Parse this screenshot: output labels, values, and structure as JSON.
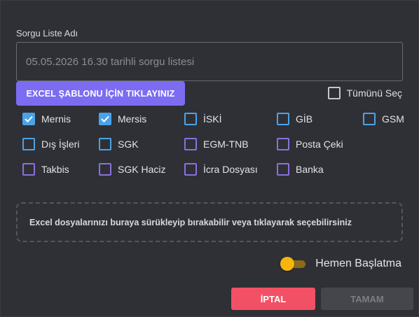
{
  "form": {
    "list_name_label": "Sorgu Liste Adı",
    "list_name_placeholder": "05.05.2026 16.30 tarihli sorgu listesi",
    "excel_template_button": "EXCEL ŞABLONU İÇİN TIKLAYINIZ",
    "select_all_label": "Tümünü Seç"
  },
  "sources": [
    {
      "id": "mernis",
      "label": "Mernis",
      "checked": true,
      "color": "#4aa3e8"
    },
    {
      "id": "mersis",
      "label": "Mersis",
      "checked": true,
      "color": "#4aa3e8"
    },
    {
      "id": "iski",
      "label": "İSKİ",
      "checked": false,
      "color": "#4aa3e8"
    },
    {
      "id": "gib",
      "label": "GİB",
      "checked": false,
      "color": "#4aa3e8"
    },
    {
      "id": "gsm",
      "label": "GSM",
      "checked": false,
      "color": "#4aa3e8"
    },
    {
      "id": "dis-isleri",
      "label": "Dış İşleri",
      "checked": false,
      "color": "#4aa3e8"
    },
    {
      "id": "sgk",
      "label": "SGK",
      "checked": false,
      "color": "#4aa3e8"
    },
    {
      "id": "egm-tnb",
      "label": "EGM-TNB",
      "checked": false,
      "color": "#8b6fe0"
    },
    {
      "id": "posta-ceki",
      "label": "Posta Çeki",
      "checked": false,
      "color": "#8b6fe0"
    },
    {
      "id": "takbis",
      "label": "Takbis",
      "checked": false,
      "color": "#8b6fe0"
    },
    {
      "id": "sgk-haciz",
      "label": "SGK Haciz",
      "checked": false,
      "color": "#8b6fe0"
    },
    {
      "id": "icra-dosyasi",
      "label": "İcra Dosyası",
      "checked": false,
      "color": "#8b6fe0"
    },
    {
      "id": "banka",
      "label": "Banka",
      "checked": false,
      "color": "#8b6fe0"
    }
  ],
  "dropzone": {
    "text": "Excel dosyalarınızı buraya sürükleyip bırakabilir veya tıklayarak seçebilirsiniz"
  },
  "options": {
    "immediate_start_label": "Hemen Başlatma",
    "immediate_start_on": true,
    "toggle_color": "#f6b40c"
  },
  "actions": {
    "cancel_label": "İPTAL",
    "ok_label": "TAMAM",
    "cancel_color": "#f25064"
  }
}
